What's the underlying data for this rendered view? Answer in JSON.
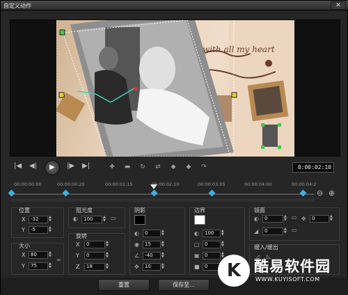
{
  "window": {
    "title": "自定义动作",
    "close": "✕"
  },
  "transport": {
    "timecode": "0:00:02:10"
  },
  "timeline": {
    "ticks": [
      "00:00:00:00",
      "00:00:00:20",
      "00:00:01:15",
      "00:00:02:10",
      "00:00:03:05",
      "00:00:04:00",
      "00:00:04:2"
    ],
    "keyframe_positions": [
      0,
      0.18,
      0.47,
      0.66,
      0.96
    ],
    "playhead_position": 0.47
  },
  "position": {
    "title": "位置",
    "x_label": "X",
    "x": "-32",
    "y_label": "Y",
    "y": "-5"
  },
  "size": {
    "title": "大小",
    "x_label": "X",
    "x": "80",
    "y_label": "Y",
    "y": "75"
  },
  "opacity": {
    "title": "阻光度",
    "value": "100"
  },
  "rotation": {
    "title": "旋转",
    "x_label": "X",
    "x": "0",
    "y_label": "Y",
    "y": "0",
    "z_label": "Z",
    "z": "18"
  },
  "shadow": {
    "title": "阴影",
    "color": "#000000",
    "opacity": "0",
    "blur": "15",
    "angle": "-40",
    "distance": "10"
  },
  "border": {
    "title": "边界",
    "color": "#ffffff",
    "opacity": "100",
    "size": "0",
    "f1": "0",
    "f2": "0"
  },
  "mirror": {
    "title": "镜面",
    "opacity": "0",
    "a": "0",
    "b": "0"
  },
  "fade": {
    "title": "缓入/缓出"
  },
  "buttons": {
    "reset": "重置",
    "save": "保存至..."
  },
  "watermark": {
    "brand": "酷易软件园",
    "url": "WWW.KUYISOFT.COM",
    "logo": "K"
  },
  "photo": {
    "text": "with all my heart"
  }
}
